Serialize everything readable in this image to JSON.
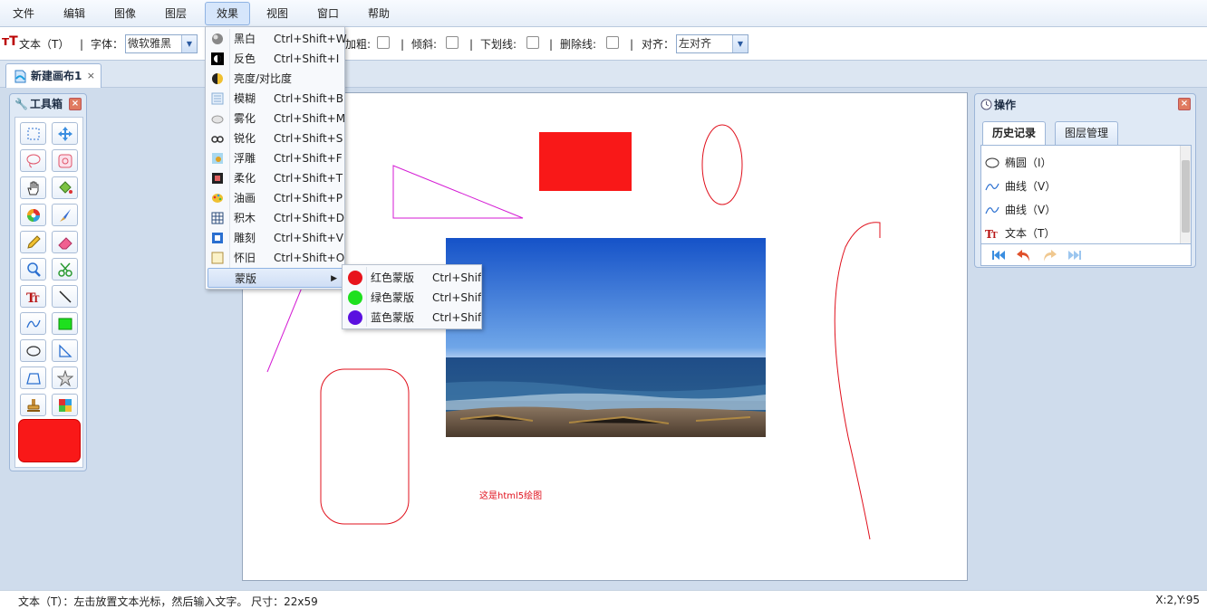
{
  "menubar": {
    "items": [
      "文件",
      "编辑",
      "图像",
      "图层",
      "效果",
      "视图",
      "窗口",
      "帮助"
    ],
    "active": "效果"
  },
  "toolbar": {
    "tool_label": "文本（T）",
    "font_label": "字体：",
    "font_value": "微软雅黑",
    "bold_label": "加粗:",
    "italic_label": "倾斜:",
    "underline_label": "下划线:",
    "strike_label": "删除线:",
    "align_label": "对齐：",
    "align_value": "左对齐"
  },
  "tabs": {
    "doc_tab": "新建画布1",
    "close": "×"
  },
  "toolbox": {
    "title": "工具箱",
    "close": "×",
    "tools": [
      "rect-select-icon",
      "move-icon",
      "lasso-icon",
      "magic-select-icon",
      "hand-icon",
      "paint-bucket-icon",
      "color-wheel-icon",
      "brush-icon",
      "pencil-icon",
      "eraser-icon",
      "zoom-icon",
      "scissors-icon",
      "text-icon",
      "line-icon",
      "curve-icon",
      "fill-rect-icon",
      "ellipse-icon",
      "triangle-icon",
      "polygon-icon",
      "star-icon",
      "stamp-icon",
      "gradient-icon"
    ],
    "current_color": "#f91818"
  },
  "canvas": {
    "caption": "这是html5绘图",
    "fill_color": "#f91818",
    "stroke_red": "#e0101c",
    "stroke_magenta": "#d41ad4"
  },
  "operations": {
    "title": "操作",
    "close": "×",
    "tab_history": "历史记录",
    "tab_layers": "图层管理",
    "history": [
      {
        "icon": "ellipse-icon",
        "label": "椭圆（I）"
      },
      {
        "icon": "curve-icon",
        "label": "曲线（V）"
      },
      {
        "icon": "curve-icon",
        "label": "曲线（V）"
      },
      {
        "icon": "text-icon",
        "label": "文本（T）"
      }
    ]
  },
  "effects_menu": {
    "items": [
      {
        "label": "黑白",
        "shortcut": "Ctrl+Shift+W",
        "icon": "grayscale-icon"
      },
      {
        "label": "反色",
        "shortcut": "Ctrl+Shift+I",
        "icon": "invert-icon"
      },
      {
        "label": "亮度/对比度",
        "shortcut": "",
        "icon": "brightness-icon"
      },
      {
        "label": "模糊",
        "shortcut": "Ctrl+Shift+B",
        "icon": "blur-icon"
      },
      {
        "label": "雾化",
        "shortcut": "Ctrl+Shift+M",
        "icon": "fog-icon"
      },
      {
        "label": "锐化",
        "shortcut": "Ctrl+Shift+S",
        "icon": "sharpen-icon"
      },
      {
        "label": "浮雕",
        "shortcut": "Ctrl+Shift+F",
        "icon": "emboss-icon"
      },
      {
        "label": "柔化",
        "shortcut": "Ctrl+Shift+T",
        "icon": "soften-icon"
      },
      {
        "label": "油画",
        "shortcut": "Ctrl+Shift+P",
        "icon": "oil-paint-icon"
      },
      {
        "label": "积木",
        "shortcut": "Ctrl+Shift+D",
        "icon": "mosaic-icon"
      },
      {
        "label": "雕刻",
        "shortcut": "Ctrl+Shift+V",
        "icon": "engrave-icon"
      },
      {
        "label": "怀旧",
        "shortcut": "Ctrl+Shift+O",
        "icon": "sepia-icon"
      },
      {
        "label": "蒙版",
        "shortcut": "",
        "icon": "",
        "submenu": true
      }
    ]
  },
  "mask_menu": {
    "items": [
      {
        "label": "红色蒙版",
        "shortcut": "Ctrl+Shift",
        "color": "#e8141c"
      },
      {
        "label": "绿色蒙版",
        "shortcut": "Ctrl+Shift",
        "color": "#1ee01e"
      },
      {
        "label": "蓝色蒙版",
        "shortcut": "Ctrl+Shift",
        "color": "#5a10e0"
      }
    ]
  },
  "status": {
    "text": "文本（T）：左击放置文本光标，然后输入文字。 尺寸：22x59",
    "coords": "X:2,Y:95"
  }
}
